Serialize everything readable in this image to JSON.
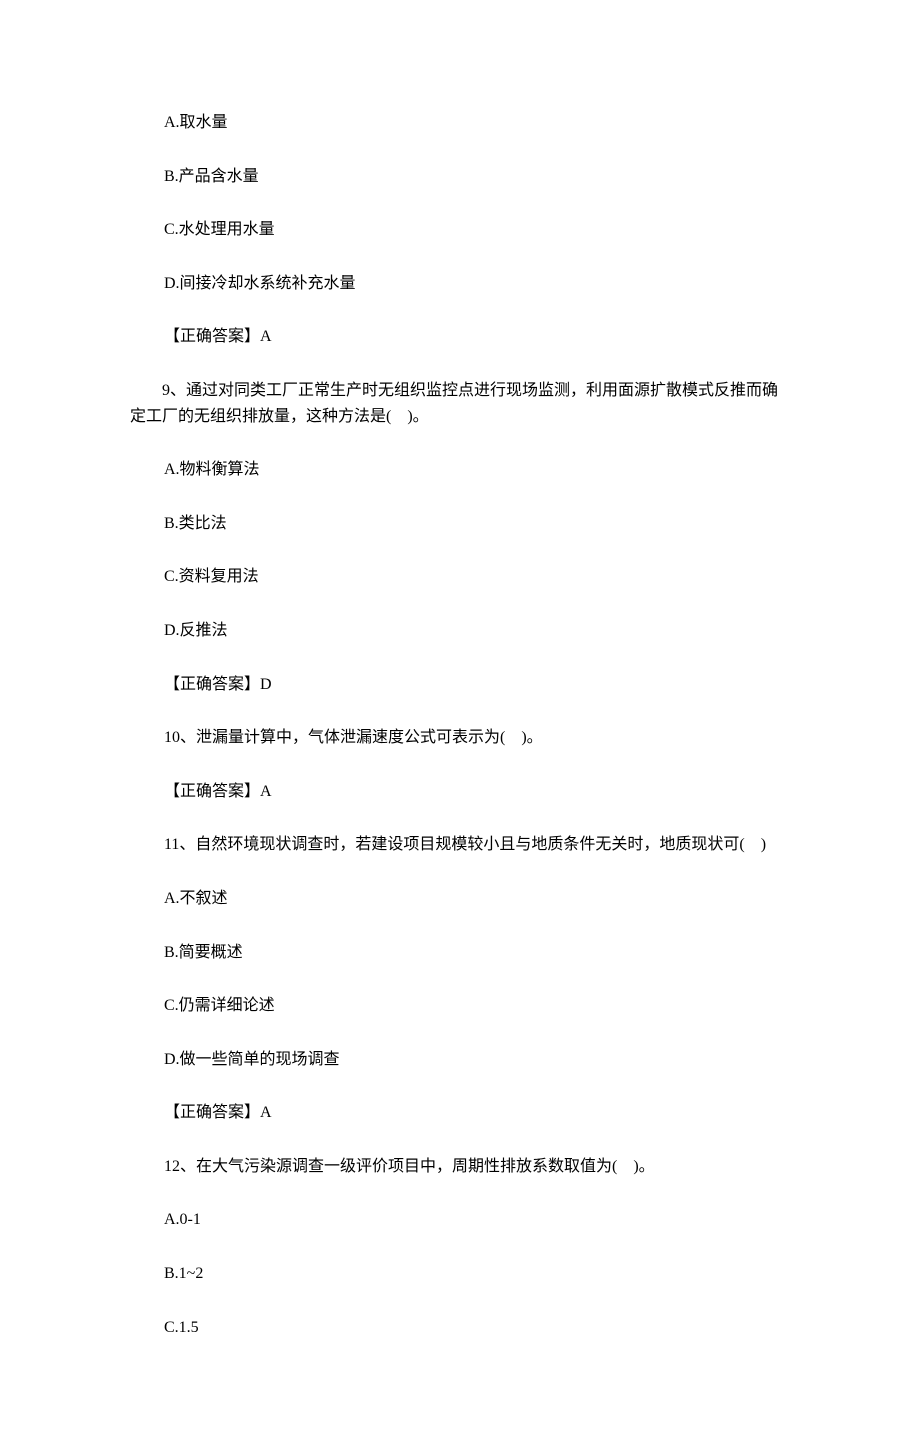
{
  "blocks": [
    {
      "cls": "line option",
      "text": "A.取水量"
    },
    {
      "cls": "line option",
      "text": "B.产品含水量"
    },
    {
      "cls": "line option",
      "text": "C.水处理用水量"
    },
    {
      "cls": "line option",
      "text": "D.间接冷却水系统补充水量"
    },
    {
      "cls": "line option",
      "text": "【正确答案】A"
    },
    {
      "cls": "line question-wrap",
      "text": "　　9、通过对同类工厂正常生产时无组织监控点进行现场监测，利用面源扩散模式反推而确定工厂的无组织排放量，这种方法是(　)。"
    },
    {
      "cls": "line option",
      "text": "A.物料衡算法"
    },
    {
      "cls": "line option",
      "text": "B.类比法"
    },
    {
      "cls": "line option",
      "text": "C.资料复用法"
    },
    {
      "cls": "line option",
      "text": "D.反推法"
    },
    {
      "cls": "line option",
      "text": "【正确答案】D"
    },
    {
      "cls": "line option",
      "text": "10、泄漏量计算中，气体泄漏速度公式可表示为(　)。"
    },
    {
      "cls": "line option",
      "text": "【正确答案】A"
    },
    {
      "cls": "line option",
      "text": "11、自然环境现状调查时，若建设项目规模较小且与地质条件无关时，地质现状可(　)"
    },
    {
      "cls": "line option",
      "text": "A.不叙述"
    },
    {
      "cls": "line option",
      "text": "B.简要概述"
    },
    {
      "cls": "line option",
      "text": "C.仍需详细论述"
    },
    {
      "cls": "line option",
      "text": "D.做一些简单的现场调查"
    },
    {
      "cls": "line option",
      "text": "【正确答案】A"
    },
    {
      "cls": "line option",
      "text": "12、在大气污染源调查一级评价项目中，周期性排放系数取值为(　)。"
    },
    {
      "cls": "line option",
      "text": "A.0-1"
    },
    {
      "cls": "line option",
      "text": "B.1~2"
    },
    {
      "cls": "line option",
      "text": "C.1.5"
    }
  ]
}
